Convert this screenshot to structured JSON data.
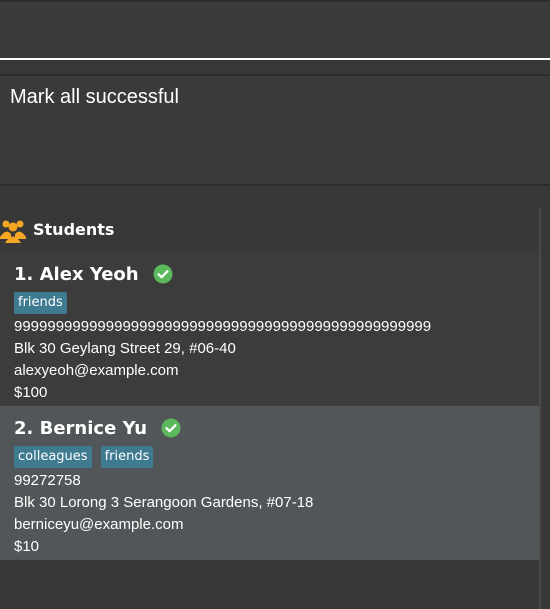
{
  "command": {
    "value": ""
  },
  "result": {
    "text": "Mark all successful"
  },
  "panel": {
    "title": "Students",
    "icon": "group-icon"
  },
  "students": [
    {
      "index_name": "1. Alex Yeoh",
      "status_icon": "check-circle-icon",
      "tags": [
        "friends"
      ],
      "phone": "99999999999999999999999999999999999999999999999999",
      "address": "Blk 30 Geylang Street 29, #06-40",
      "email": "alexyeoh@example.com",
      "amount": "$100"
    },
    {
      "index_name": "2. Bernice Yu",
      "status_icon": "check-circle-icon",
      "tags": [
        "colleagues",
        "friends"
      ],
      "phone": "99272758",
      "address": "Blk 30 Lorong 3 Serangoon Gardens, #07-18",
      "email": "berniceyu@example.com",
      "amount": "$10"
    }
  ],
  "colors": {
    "tag_bg": "#3e7b91",
    "check": "#5cb85c",
    "icon_orange": "#f5a623"
  }
}
